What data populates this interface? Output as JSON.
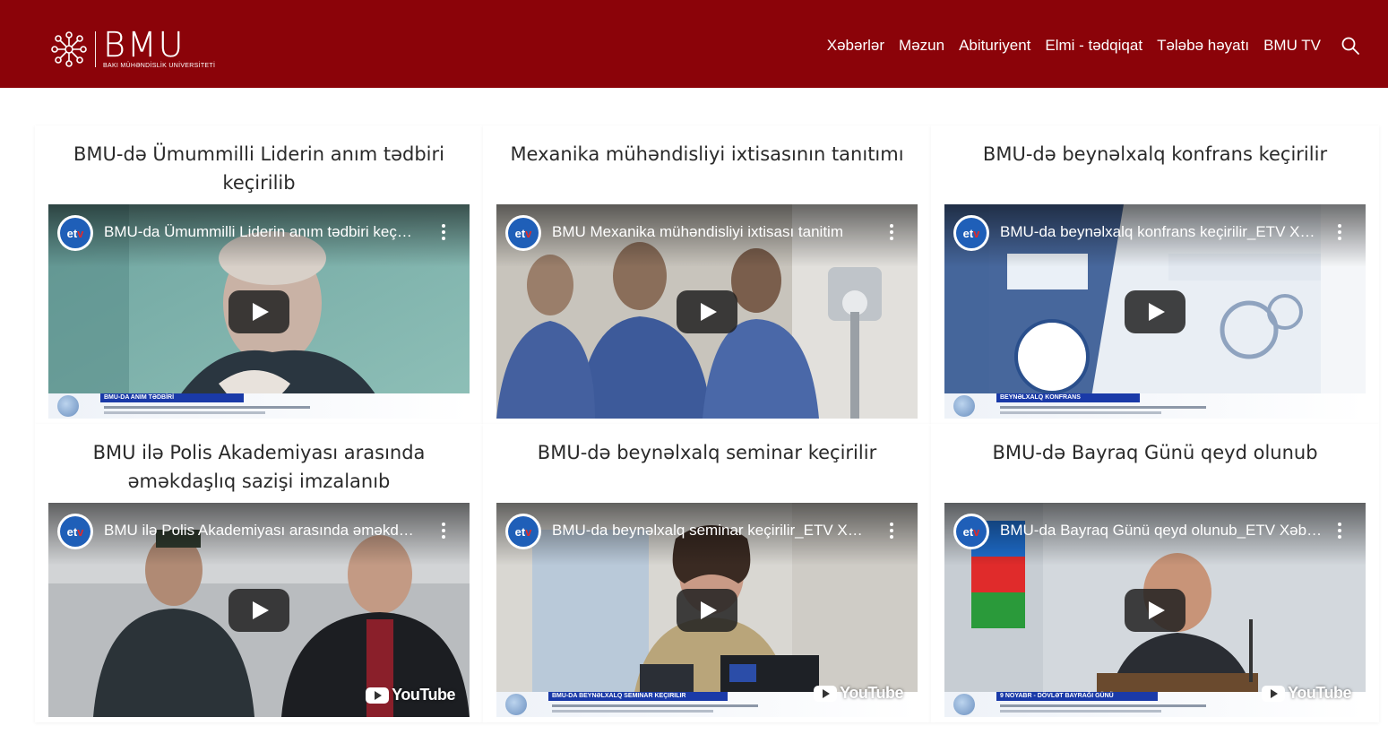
{
  "header": {
    "logo_text": "BMU",
    "logo_subtitle": "BAKI MÜHƏNDİSLİK UNİVERSİTETİ",
    "nav": [
      "Xəbərlər",
      "Məzun",
      "Abituriyent",
      "Elmi - tədqiqat",
      "Tələbə həyatı",
      "BMU TV"
    ],
    "search_icon": "search-icon",
    "bg_color": "#8b0309"
  },
  "cards": [
    {
      "title": "BMU-də Ümummilli Liderin anım tədbiri keçirilib",
      "video_title": "BMU-da Ümummilli Liderin anım tədbiri keç…",
      "lower_third": "BMU-DA ANIM TƏDBİRİ",
      "youtube_label": ""
    },
    {
      "title": "Mexanika mühəndisliyi ixtisasının tanıtımı",
      "video_title": "BMU Mexanika mühəndisliyi ixtisası tanitim",
      "lower_third": "",
      "youtube_label": ""
    },
    {
      "title": "BMU-də beynəlxalq konfrans keçirilir",
      "video_title": "BMU-da beynəlxalq konfrans keçirilir_ETV X…",
      "lower_third": "BEYNƏLXALQ KONFRANS",
      "youtube_label": ""
    },
    {
      "title": "BMU ilə Polis Akademiyası arasında əməkdaşlıq sazişi imzalanıb",
      "video_title": "BMU ilə Polis Akademiyası arasında əməkd…",
      "lower_third": "",
      "youtube_label": "YouTube"
    },
    {
      "title": "BMU-də beynəlxalq seminar keçirilir",
      "video_title": "BMU-da beynəlxalq seminar keçirilir_ETV X…",
      "lower_third": "BMU-DA BEYNƏLXALQ SEMINAR KEÇIRILIR",
      "youtube_label": "YouTube"
    },
    {
      "title": "BMU-də Bayraq Günü qeyd olunub",
      "video_title": "BMU-da Bayraq Günü qeyd olunub_ETV Xəb…",
      "lower_third": "9 NOYABR - DÖVLƏT BAYRAĞI GÜNÜ",
      "youtube_label": "YouTube"
    }
  ],
  "etv_logo_text": "et",
  "etv_logo_accent": "v"
}
